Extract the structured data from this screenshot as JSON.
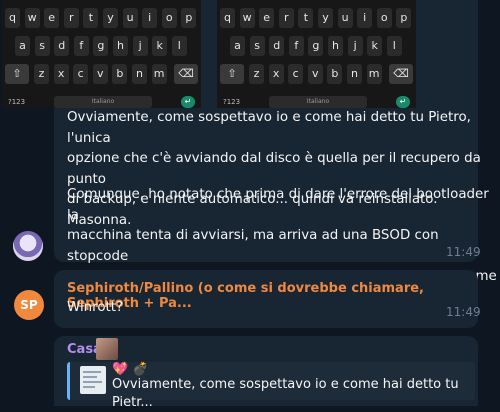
{
  "keyboard": {
    "row1": [
      "q",
      "w",
      "e",
      "r",
      "t",
      "y",
      "u",
      "i",
      "o",
      "p"
    ],
    "row2": [
      "a",
      "s",
      "d",
      "f",
      "g",
      "h",
      "j",
      "k",
      "l"
    ],
    "row3": [
      "z",
      "x",
      "c",
      "v",
      "b",
      "n",
      "m"
    ],
    "shift_glyph": "⇧",
    "backspace_glyph": "⌫",
    "numbers_label": "?123",
    "space_label": "Italiano",
    "enter_glyph": "↵"
  },
  "messages": [
    {
      "paragraph1": "Ovviamente, come sospettavo io e come hai detto tu Pietro, l'unica\nopzione che c'è avviando dal disco è quella per il recupero da punto\ndi backup, e niente automatico... quindi va reinstallato. Masonna.",
      "paragraph2": "Comunque, ho notato che prima di dare l'errore del bootloader la\nmacchina tenta di avviarsi, ma arriva ad una BSOD con stopcode\nCLOCK_WATCHDOG_TIMEOUT, che non so cosa sia ma dal nome\nnon mi sembra ci azzecchi molto",
      "time": "11:49"
    },
    {
      "avatar_initials": "SP",
      "sender": "Sephiroth/Pallino (o come si dovrebbe chiamare, Sephiroth + Pa...",
      "sender_color": "#f0883e",
      "text": "Winrott?",
      "time": "11:49"
    },
    {
      "sender": "Casa",
      "sender_color": "#b68cf0",
      "reply_emojis": "💖 💣",
      "reply_text": "Ovviamente, come sospettavo io e come hai detto tu Pietr..."
    }
  ]
}
